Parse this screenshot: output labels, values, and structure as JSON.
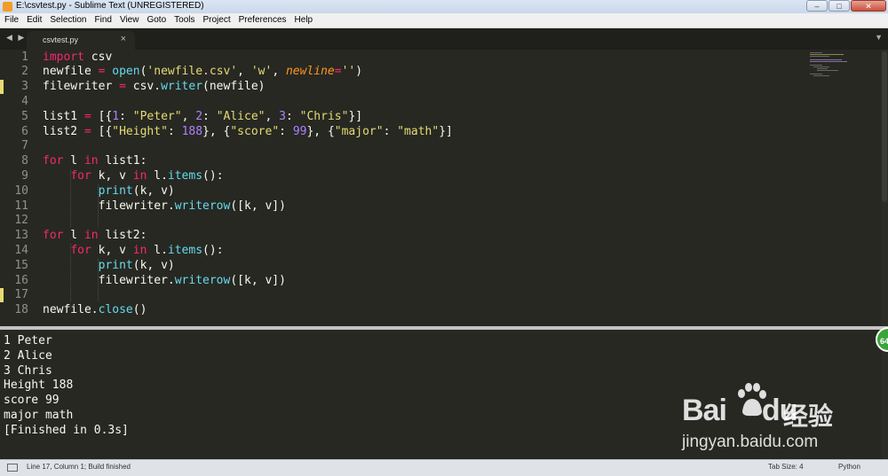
{
  "window": {
    "title": "E:\\csvtest.py - Sublime Text (UNREGISTERED)",
    "buttons": [
      "–",
      "□",
      "✕"
    ]
  },
  "menu": [
    "File",
    "Edit",
    "Selection",
    "Find",
    "View",
    "Goto",
    "Tools",
    "Project",
    "Preferences",
    "Help"
  ],
  "tabs": {
    "nav": "◀ ▶",
    "active": {
      "title": "csvtest.py",
      "close": "×"
    },
    "dropdown": "▼"
  },
  "editor": {
    "line_numbers": [
      "1",
      "2",
      "3",
      "4",
      "5",
      "6",
      "7",
      "8",
      "9",
      "10",
      "11",
      "12",
      "13",
      "14",
      "15",
      "16",
      "17",
      "18"
    ],
    "modified_lines": [
      3,
      17
    ],
    "code": [
      [
        {
          "t": "import",
          "c": "kw"
        },
        {
          "t": " csv",
          "c": ""
        }
      ],
      [
        {
          "t": "newfile ",
          "c": ""
        },
        {
          "t": "=",
          "c": "kw"
        },
        {
          "t": " ",
          "c": ""
        },
        {
          "t": "open",
          "c": "fn"
        },
        {
          "t": "(",
          "c": ""
        },
        {
          "t": "'newfile.csv'",
          "c": "str"
        },
        {
          "t": ", ",
          "c": ""
        },
        {
          "t": "'w'",
          "c": "str"
        },
        {
          "t": ", ",
          "c": ""
        },
        {
          "t": "newline",
          "c": "param"
        },
        {
          "t": "=",
          "c": "kw"
        },
        {
          "t": "''",
          "c": "str"
        },
        {
          "t": ")",
          "c": ""
        }
      ],
      [
        {
          "t": "filewriter ",
          "c": ""
        },
        {
          "t": "=",
          "c": "kw"
        },
        {
          "t": " csv.",
          "c": ""
        },
        {
          "t": "writer",
          "c": "fn"
        },
        {
          "t": "(newfile)",
          "c": ""
        }
      ],
      [],
      [
        {
          "t": "list1 ",
          "c": ""
        },
        {
          "t": "=",
          "c": "kw"
        },
        {
          "t": " [{",
          "c": ""
        },
        {
          "t": "1",
          "c": "num"
        },
        {
          "t": ": ",
          "c": ""
        },
        {
          "t": "\"Peter\"",
          "c": "str"
        },
        {
          "t": ", ",
          "c": ""
        },
        {
          "t": "2",
          "c": "num"
        },
        {
          "t": ": ",
          "c": ""
        },
        {
          "t": "\"Alice\"",
          "c": "str"
        },
        {
          "t": ", ",
          "c": ""
        },
        {
          "t": "3",
          "c": "num"
        },
        {
          "t": ": ",
          "c": ""
        },
        {
          "t": "\"Chris\"",
          "c": "str"
        },
        {
          "t": "}]",
          "c": ""
        }
      ],
      [
        {
          "t": "list2 ",
          "c": ""
        },
        {
          "t": "=",
          "c": "kw"
        },
        {
          "t": " [{",
          "c": ""
        },
        {
          "t": "\"Height\"",
          "c": "str"
        },
        {
          "t": ": ",
          "c": ""
        },
        {
          "t": "188",
          "c": "num"
        },
        {
          "t": "}, {",
          "c": ""
        },
        {
          "t": "\"score\"",
          "c": "str"
        },
        {
          "t": ": ",
          "c": ""
        },
        {
          "t": "99",
          "c": "num"
        },
        {
          "t": "}, {",
          "c": ""
        },
        {
          "t": "\"major\"",
          "c": "str"
        },
        {
          "t": ": ",
          "c": ""
        },
        {
          "t": "\"math\"",
          "c": "str"
        },
        {
          "t": "}]",
          "c": ""
        }
      ],
      [],
      [
        {
          "t": "for",
          "c": "kw"
        },
        {
          "t": " l ",
          "c": ""
        },
        {
          "t": "in",
          "c": "kw"
        },
        {
          "t": " list1:",
          "c": ""
        }
      ],
      [
        {
          "t": "    ",
          "c": ""
        },
        {
          "t": "for",
          "c": "kw"
        },
        {
          "t": " k, v ",
          "c": ""
        },
        {
          "t": "in",
          "c": "kw"
        },
        {
          "t": " l.",
          "c": ""
        },
        {
          "t": "items",
          "c": "fn"
        },
        {
          "t": "():",
          "c": ""
        }
      ],
      [
        {
          "t": "        ",
          "c": ""
        },
        {
          "t": "print",
          "c": "fn"
        },
        {
          "t": "(k, v)",
          "c": ""
        }
      ],
      [
        {
          "t": "        filewriter.",
          "c": ""
        },
        {
          "t": "writerow",
          "c": "fn"
        },
        {
          "t": "([k, v])",
          "c": ""
        }
      ],
      [],
      [
        {
          "t": "for",
          "c": "kw"
        },
        {
          "t": " l ",
          "c": ""
        },
        {
          "t": "in",
          "c": "kw"
        },
        {
          "t": " list2:",
          "c": ""
        }
      ],
      [
        {
          "t": "    ",
          "c": ""
        },
        {
          "t": "for",
          "c": "kw"
        },
        {
          "t": " k, v ",
          "c": ""
        },
        {
          "t": "in",
          "c": "kw"
        },
        {
          "t": " l.",
          "c": ""
        },
        {
          "t": "items",
          "c": "fn"
        },
        {
          "t": "():",
          "c": ""
        }
      ],
      [
        {
          "t": "        ",
          "c": ""
        },
        {
          "t": "print",
          "c": "fn"
        },
        {
          "t": "(k, v)",
          "c": ""
        }
      ],
      [
        {
          "t": "        filewriter.",
          "c": ""
        },
        {
          "t": "writerow",
          "c": "fn"
        },
        {
          "t": "([k, v])",
          "c": ""
        }
      ],
      [],
      [
        {
          "t": "newfile.",
          "c": ""
        },
        {
          "t": "close",
          "c": "fn"
        },
        {
          "t": "()",
          "c": ""
        }
      ]
    ]
  },
  "output": {
    "lines": [
      "1 Peter",
      "2 Alice",
      "3 Chris",
      "Height 188",
      "score 99",
      "major math",
      "[Finished in 0.3s]"
    ]
  },
  "badge": "64",
  "watermark": {
    "brand": "Bai",
    "brand_du": "du",
    "cn": "经验",
    "url": "jingyan.baidu.com"
  },
  "statusbar": {
    "position": "Line 17, Column 1; Build finished",
    "tab_size": "Tab Size: 4",
    "syntax": "Python"
  },
  "colors": {
    "background": "#272822",
    "keyword": "#f92672",
    "string": "#e6db74",
    "number": "#ae81ff",
    "function": "#66d9ef",
    "parameter": "#fd971f"
  }
}
